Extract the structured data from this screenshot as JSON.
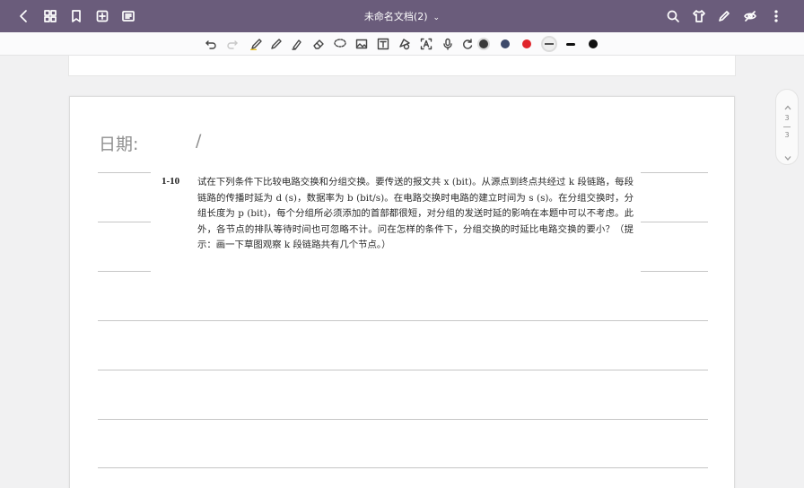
{
  "topbar": {
    "title": "未命名文档(2)",
    "icons": [
      "back-icon",
      "grid-icon",
      "bookmark-icon",
      "add-page-icon",
      "fullscreen-icon",
      "search-icon",
      "shirt-icon",
      "pen-icon",
      "eye-off-icon",
      "more-icon"
    ]
  },
  "toolbar": {
    "tools": [
      "undo-icon",
      "redo-icon",
      "highlighter-icon",
      "pen-icon",
      "marker-icon",
      "eraser-icon",
      "lasso-icon",
      "image-icon",
      "text-icon",
      "shape-icon",
      "ocr-text-icon",
      "mic-icon",
      "refresh-icon"
    ],
    "colors": [
      "#3a3a3a",
      "#3d4a6b",
      "#e0242b",
      "#6a6a6a"
    ],
    "stroke_sizes": [
      "medium",
      "large"
    ]
  },
  "page": {
    "date_label": "日期:",
    "date_separator": "/",
    "problem_number": "1-10",
    "problem_text": "试在下列条件下比较电路交换和分组交换。要传送的报文共 x (bit)。从源点到终点共经过 k 段链路，每段链路的传播时延为 d (s)，数据率为 b (bit/s)。在电路交换时电路的建立时间为 s (s)。在分组交换时，分组长度为 p (bit)，每个分组所必须添加的首部都很短，对分组的发送时延的影响在本题中可以不考虑。此外，各节点的排队等待时间也可忽略不计。问在怎样的条件下，分组交换的时延比电路交换的要小？（提示：画一下草图观察 k 段链路共有几个节点。）"
  },
  "pager": {
    "current": "3",
    "total": "3"
  }
}
